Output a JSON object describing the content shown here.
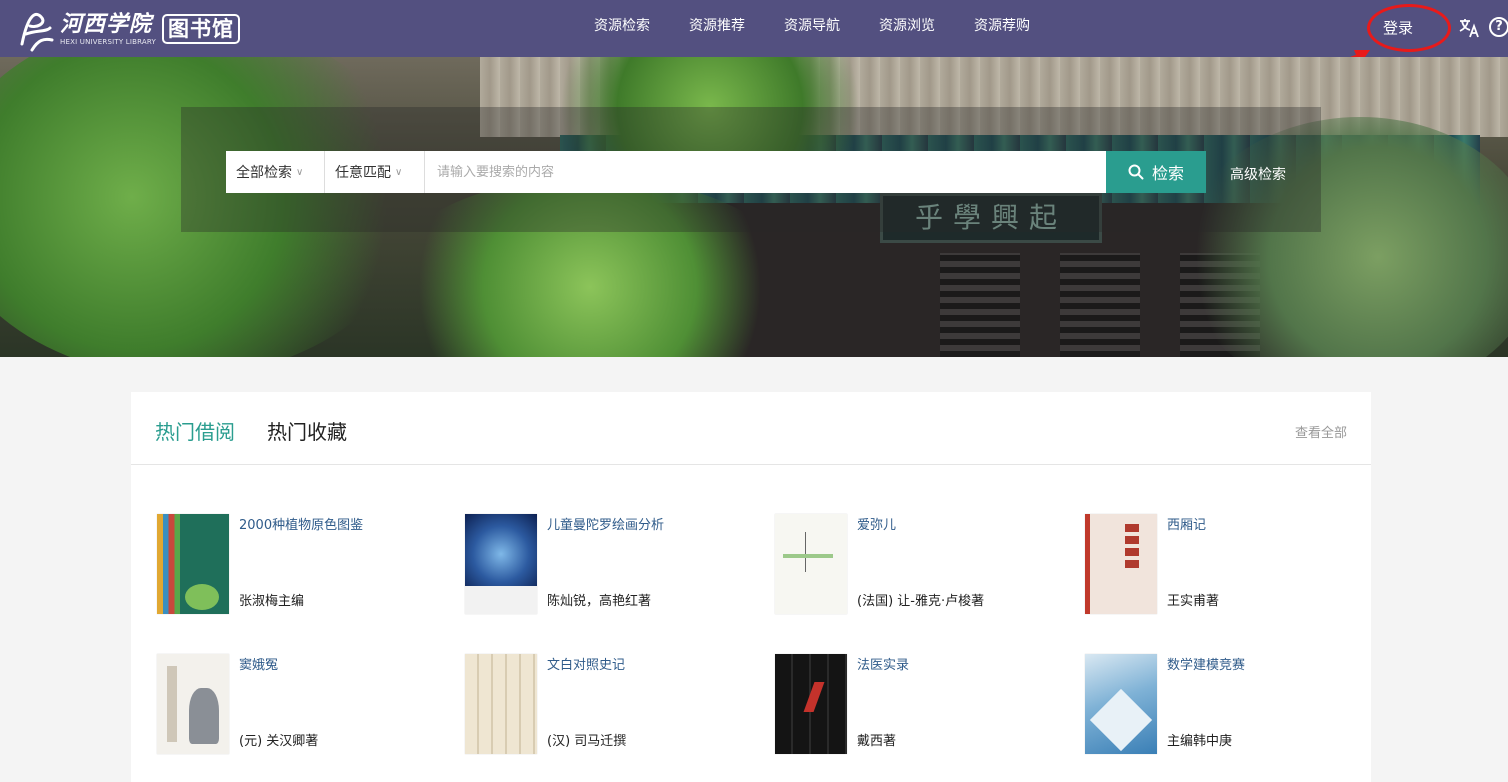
{
  "header": {
    "logo_cn": "河西学院",
    "logo_en": "HEXI UNIVERSITY LIBRARY",
    "logo_lib": "图书馆",
    "nav": [
      "资源检索",
      "资源推荐",
      "资源导航",
      "资源浏览",
      "资源荐购"
    ],
    "login_label": "登录",
    "help_label": "?"
  },
  "banner": {
    "plaque_text": "乎學興起"
  },
  "search": {
    "scope_label": "全部检索",
    "match_label": "任意匹配",
    "placeholder": "请输入要搜索的内容",
    "button_label": "检索",
    "advanced_label": "高级检索"
  },
  "section": {
    "tabs": [
      {
        "label": "热门借阅",
        "active": true
      },
      {
        "label": "热门收藏",
        "active": false
      }
    ],
    "view_all_label": "查看全部"
  },
  "books": [
    {
      "title": "2000种植物原色图鉴",
      "author": "张淑梅主编"
    },
    {
      "title": "儿童曼陀罗绘画分析",
      "author": "陈灿锐，高艳红著"
    },
    {
      "title": "爱弥儿",
      "author": "(法国) 让-雅克·卢梭著"
    },
    {
      "title": "西厢记",
      "author": "王实甫著"
    },
    {
      "title": "窦娥冤",
      "author": "(元) 关汉卿著"
    },
    {
      "title": "文白对照史记",
      "author": "(汉) 司马迁撰"
    },
    {
      "title": "法医实录",
      "author": "戴西著"
    },
    {
      "title": "数学建模竞赛",
      "author": "主编韩中庚"
    }
  ],
  "colors": {
    "header_bg": "#535080",
    "accent": "#2a9d8f",
    "link": "#2f5b8a",
    "highlight": "#e81a1a"
  }
}
